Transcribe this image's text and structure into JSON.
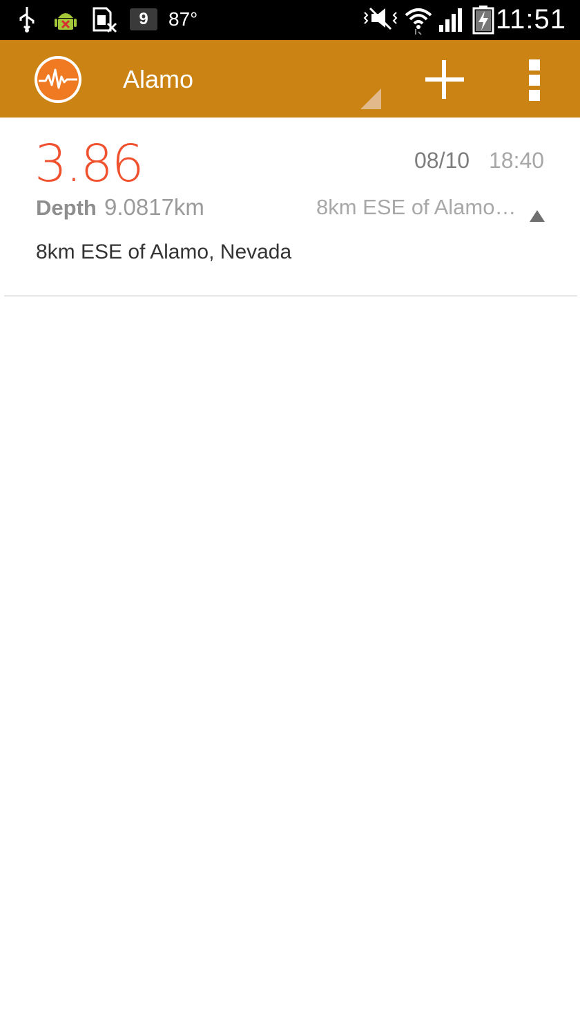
{
  "status_bar": {
    "icons": [
      "usb-icon",
      "android-debug-icon",
      "sim-card-disabled-icon",
      "notification-count-icon",
      "vibrate-icon",
      "wifi-icon",
      "signal-icon",
      "battery-charging-icon"
    ],
    "notification_count": "9",
    "temperature": "87°",
    "clock": "11:51"
  },
  "action_bar": {
    "title": "Alamo",
    "color": "#cb8414",
    "logo_icon": "seismograph-logo-icon",
    "add_icon": "plus-icon",
    "overflow_icon": "overflow-menu-icon"
  },
  "earthquakes": [
    {
      "magnitude": "3.86",
      "date": "08/10",
      "time": "18:40",
      "depth_label": "Depth",
      "depth_value": "9.0817km",
      "place_short": "8km ESE of Alamo, Nevada",
      "place_full": "8km ESE of Alamo, Nevada",
      "magnitude_color": "#f0512e"
    }
  ]
}
